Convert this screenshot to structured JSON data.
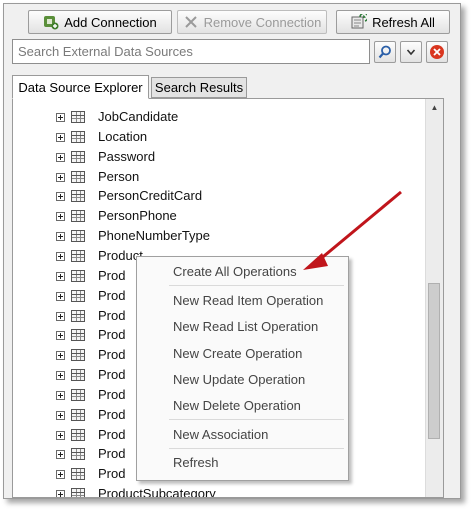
{
  "toolbar": {
    "add_connection": "Add Connection",
    "remove_connection": "Remove Connection",
    "refresh_all": "Refresh All"
  },
  "search": {
    "placeholder": "Search External Data Sources"
  },
  "tabs": [
    {
      "label": "Data Source Explorer",
      "active": true
    },
    {
      "label": "Search Results",
      "active": false
    }
  ],
  "tree": {
    "items": [
      "JobCandidate",
      "Location",
      "Password",
      "Person",
      "PersonCreditCard",
      "PersonPhone",
      "PhoneNumberType",
      "Product",
      "Prod",
      "Prod",
      "Prod",
      "Prod",
      "Prod",
      "Prod",
      "Prod",
      "Prod",
      "Prod",
      "Prod",
      "Prod",
      "ProductSubcategory"
    ]
  },
  "context_menu": {
    "items": [
      "Create All Operations",
      "New Read Item Operation",
      "New Read List Operation",
      "New Create Operation",
      "New Update Operation",
      "New Delete Operation",
      "New Association",
      "Refresh"
    ]
  },
  "colors": {
    "annotation_arrow": "#c0151b",
    "delete_icon": "#d9361f",
    "search_icon": "#2a5fa8"
  }
}
